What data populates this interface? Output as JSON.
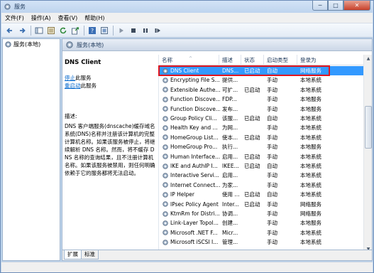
{
  "window": {
    "title": "服务",
    "buttons": {
      "min": "─",
      "max": "□",
      "close": "✕"
    }
  },
  "menu": [
    "文件(F)",
    "操作(A)",
    "查看(V)",
    "帮助(H)"
  ],
  "left_pane": {
    "item": "服务(本地)"
  },
  "right_pane": {
    "header": "服务(本地)",
    "detail": {
      "service_name": "DNS Client",
      "stop_link": "停止",
      "stop_suffix": "此服务",
      "restart_link": "重启动",
      "restart_suffix": "此服务",
      "desc_label": "描述:",
      "desc_text": "DNS 客户端服务(dnscache)缓存域名系统(DNS)名称并注册该计算机的完整计算机名称。如果该服务被停止，将继续解析 DNS 名称。然而，将不缓存 DNS 名称的查询结果，且不注册计算机名称。如果该服务被禁用，则任何明确依赖于它的服务都将无法启动。"
    },
    "columns": [
      "名称",
      "描述",
      "状态",
      "启动类型",
      "登录为"
    ],
    "sort_indicator": "^",
    "services": [
      {
        "name": "DNS Client",
        "desc": "DNS...",
        "status": "已启动",
        "startup": "自动",
        "logon": "网络服务",
        "selected": true
      },
      {
        "name": "Encrypting File S...",
        "desc": "提供...",
        "status": "",
        "startup": "手动",
        "logon": "本地系统"
      },
      {
        "name": "Extensible Authe...",
        "desc": "可扩...",
        "status": "已启动",
        "startup": "手动",
        "logon": "本地系统"
      },
      {
        "name": "Function Discove...",
        "desc": "FDP...",
        "status": "",
        "startup": "手动",
        "logon": "本地服务"
      },
      {
        "name": "Function Discove...",
        "desc": "发布...",
        "status": "",
        "startup": "手动",
        "logon": "本地服务"
      },
      {
        "name": "Group Policy Cli...",
        "desc": "该服...",
        "status": "已启动",
        "startup": "自动",
        "logon": "本地系统"
      },
      {
        "name": "Health Key and ...",
        "desc": "为网...",
        "status": "",
        "startup": "手动",
        "logon": "本地系统"
      },
      {
        "name": "HomeGroup List...",
        "desc": "使本...",
        "status": "已启动",
        "startup": "手动",
        "logon": "本地系统"
      },
      {
        "name": "HomeGroup Pro...",
        "desc": "执行...",
        "status": "",
        "startup": "手动",
        "logon": "本地服务"
      },
      {
        "name": "Human Interface...",
        "desc": "启用...",
        "status": "已启动",
        "startup": "手动",
        "logon": "本地系统"
      },
      {
        "name": "IKE and AuthIP I...",
        "desc": "IKEE...",
        "status": "已启动",
        "startup": "自动",
        "logon": "本地系统"
      },
      {
        "name": "Interactive Servi...",
        "desc": "启用...",
        "status": "",
        "startup": "手动",
        "logon": "本地系统"
      },
      {
        "name": "Internet Connect...",
        "desc": "为家...",
        "status": "",
        "startup": "手动",
        "logon": "本地系统"
      },
      {
        "name": "IP Helper",
        "desc": "使用 ...",
        "status": "已启动",
        "startup": "自动",
        "logon": "本地系统"
      },
      {
        "name": "IPsec Policy Agent",
        "desc": "Inter...",
        "status": "已启动",
        "startup": "手动",
        "logon": "网络服务"
      },
      {
        "name": "KtmRm for Distri...",
        "desc": "协调...",
        "status": "",
        "startup": "手动",
        "logon": "网络服务"
      },
      {
        "name": "Link-Layer Topol...",
        "desc": "创建...",
        "status": "",
        "startup": "手动",
        "logon": "本地服务"
      },
      {
        "name": "Microsoft .NET F...",
        "desc": "Micr...",
        "status": "",
        "startup": "手动",
        "logon": "本地系统"
      },
      {
        "name": "Microsoft iSCSI I...",
        "desc": "管理...",
        "status": "",
        "startup": "手动",
        "logon": "本地系统"
      }
    ],
    "tabs": [
      "扩展",
      "标准"
    ]
  },
  "colors": {
    "selection": "#3399ff",
    "highlight_box": "#e0141e",
    "link": "#0066cc"
  }
}
